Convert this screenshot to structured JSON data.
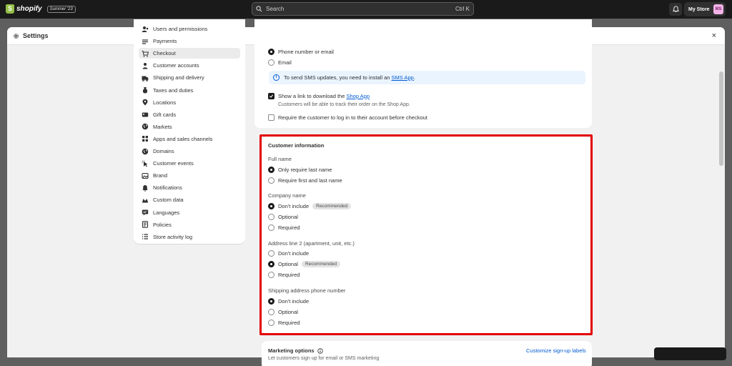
{
  "topbar": {
    "brand": "shopify",
    "edition": "Summer '23",
    "search_placeholder": "Search",
    "search_shortcut": "Ctrl K",
    "store_name": "My Store",
    "store_initials": "MS"
  },
  "window": {
    "title": "Settings",
    "close": "×"
  },
  "sidebar": {
    "items": [
      {
        "label": "Users and permissions",
        "icon": "users-icon"
      },
      {
        "label": "Payments",
        "icon": "payments-icon"
      },
      {
        "label": "Checkout",
        "icon": "cart-icon",
        "active": true
      },
      {
        "label": "Customer accounts",
        "icon": "person-icon"
      },
      {
        "label": "Shipping and delivery",
        "icon": "truck-icon"
      },
      {
        "label": "Taxes and duties",
        "icon": "tax-icon"
      },
      {
        "label": "Locations",
        "icon": "location-icon"
      },
      {
        "label": "Gift cards",
        "icon": "gift-icon"
      },
      {
        "label": "Markets",
        "icon": "globe-icon"
      },
      {
        "label": "Apps and sales channels",
        "icon": "apps-icon"
      },
      {
        "label": "Domains",
        "icon": "globe-icon"
      },
      {
        "label": "Customer events",
        "icon": "cursor-icon"
      },
      {
        "label": "Brand",
        "icon": "brand-icon"
      },
      {
        "label": "Notifications",
        "icon": "bell-icon"
      },
      {
        "label": "Custom data",
        "icon": "data-icon"
      },
      {
        "label": "Languages",
        "icon": "language-icon"
      },
      {
        "label": "Policies",
        "icon": "policy-icon"
      },
      {
        "label": "Store activity log",
        "icon": "list-icon"
      }
    ]
  },
  "contact": {
    "option_phone_or_email": "Phone number or email",
    "option_email": "Email",
    "info_text": "To send SMS updates, you need to install an",
    "info_link": "SMS App",
    "info_period": ".",
    "shop_app_label": "Show a link to download the",
    "shop_app_link": "Shop App",
    "shop_app_help": "Customers will be able to track their order on the Shop App.",
    "require_login": "Require the customer to log in to their account before checkout"
  },
  "customer_info": {
    "title": "Customer information",
    "full_name": {
      "label": "Full name",
      "options": [
        "Only require last name",
        "Require first and last name"
      ]
    },
    "company_name": {
      "label": "Company name",
      "options": [
        "Don't include",
        "Optional",
        "Required"
      ],
      "badge": "Recommended"
    },
    "address_line2": {
      "label": "Address line 2 (apartment, unit, etc.)",
      "options": [
        "Don't include",
        "Optional",
        "Required"
      ],
      "badge": "Recommended"
    },
    "shipping_phone": {
      "label": "Shipping address phone number",
      "options": [
        "Don't include",
        "Optional",
        "Required"
      ]
    }
  },
  "marketing": {
    "title": "Marketing options",
    "subtitle": "Let customers sign up for email or SMS marketing",
    "link": "Customize sign-up labels"
  },
  "colors": {
    "highlight": "#e30000",
    "link": "#005bd3",
    "topbar": "#1a1a1a"
  }
}
